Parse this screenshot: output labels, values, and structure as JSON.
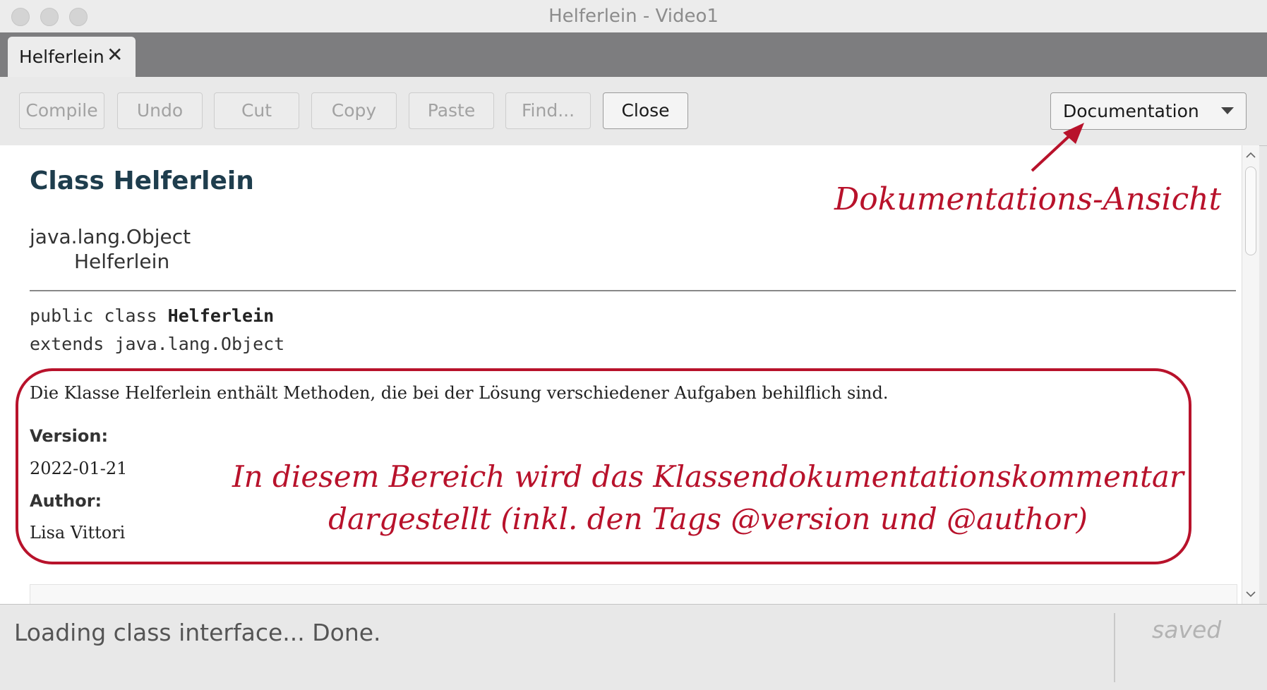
{
  "window": {
    "title": "Helferlein - Video1"
  },
  "tabs": [
    {
      "label": "Helferlein",
      "close": "✕"
    }
  ],
  "toolbar": {
    "buttons": [
      {
        "label": "Compile",
        "enabled": false
      },
      {
        "label": "Undo",
        "enabled": false
      },
      {
        "label": "Cut",
        "enabled": false
      },
      {
        "label": "Copy",
        "enabled": false
      },
      {
        "label": "Paste",
        "enabled": false
      },
      {
        "label": "Find...",
        "enabled": false
      },
      {
        "label": "Close",
        "enabled": true
      }
    ],
    "view_select": {
      "value": "Documentation"
    }
  },
  "doc": {
    "class_title": "Class Helferlein",
    "inheritance": [
      "java.lang.Object",
      "Helferlein"
    ],
    "declaration_prefix": "public class ",
    "declaration_name": "Helferlein",
    "declaration_extends": "extends java.lang.Object",
    "description": "Die Klasse Helferlein enthält Methoden, die bei der Lösung verschiedener Aufgaben behilflich sind.",
    "version_label": "Version:",
    "version_value": "2022-01-21",
    "author_label": "Author:",
    "author_value": "Lisa Vittori"
  },
  "annotations": {
    "top": "Dokumentations-Ansicht",
    "middle_line1": "In diesem Bereich wird das Klassendokumentationskommentar",
    "middle_line2": "dargestellt (inkl. den Tags @version und @author)",
    "color": "#b8122b"
  },
  "status": {
    "message": "Loading class interface... Done.",
    "saved": "saved"
  }
}
